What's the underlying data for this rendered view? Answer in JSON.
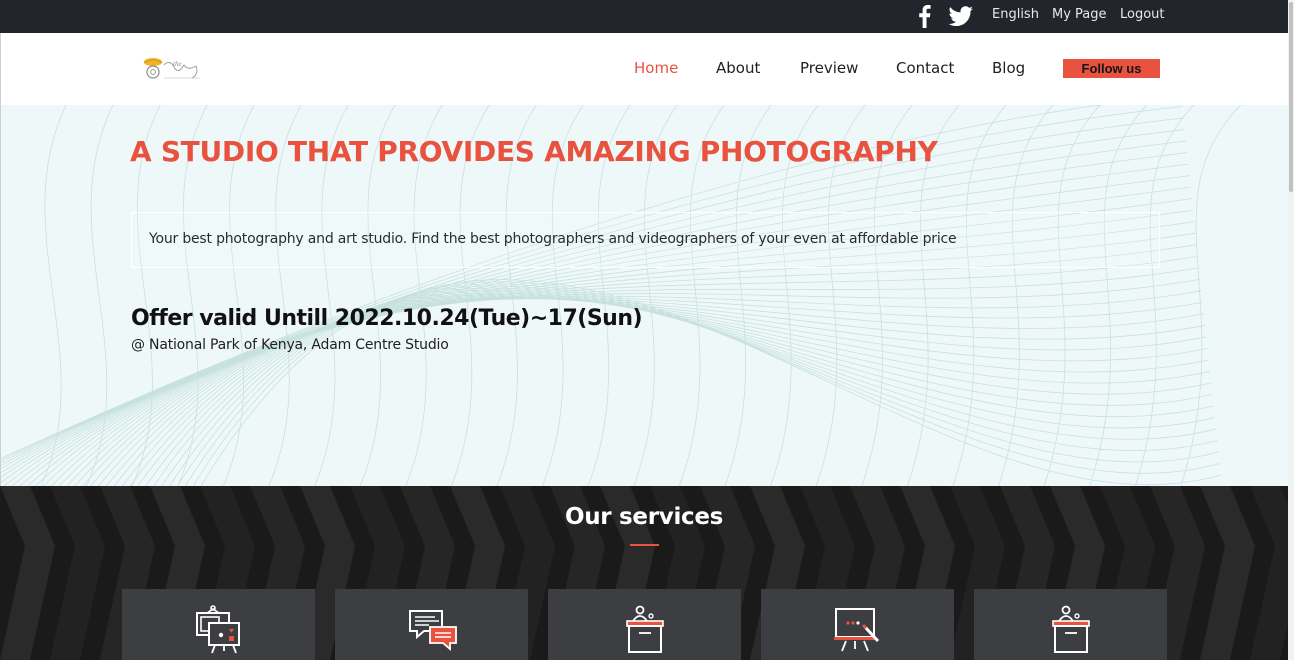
{
  "topbar": {
    "facebook_icon": "facebook-icon",
    "twitter_icon": "twitter-icon",
    "links": {
      "english": "English",
      "mypage": "My Page",
      "logout": "Logout"
    }
  },
  "nav": {
    "logo_icon": "studio-logo",
    "home": "Home",
    "about": "About",
    "preview": "Preview",
    "contact": "Contact",
    "blog": "Blog",
    "follow": "Follow us",
    "active_item": "Home"
  },
  "hero": {
    "title": "A STUDIO THAT PROVIDES AMAZING PHOTOGRAPHY",
    "tagline": "Your best photography and art studio. Find the best photographers and videographers of your even at affordable price",
    "offer": "Offer valid Untill 2022.10.24(Tue)~17(Sun)",
    "location": "@ National Park of Kenya, Adam Centre Studio"
  },
  "services": {
    "title": "Our services",
    "cards": [
      {
        "icon": "presentation-board-icon"
      },
      {
        "icon": "chat-bubbles-icon"
      },
      {
        "icon": "speaker-podium-icon"
      },
      {
        "icon": "whiteboard-easel-icon"
      },
      {
        "icon": "speaker-podium-icon"
      }
    ]
  },
  "colors": {
    "accent": "#e8523f",
    "topbar_bg": "#23252c",
    "hero_bg": "#eef8f8",
    "services_bg": "#1a1a1a",
    "card_bg": "#3d3e42"
  }
}
